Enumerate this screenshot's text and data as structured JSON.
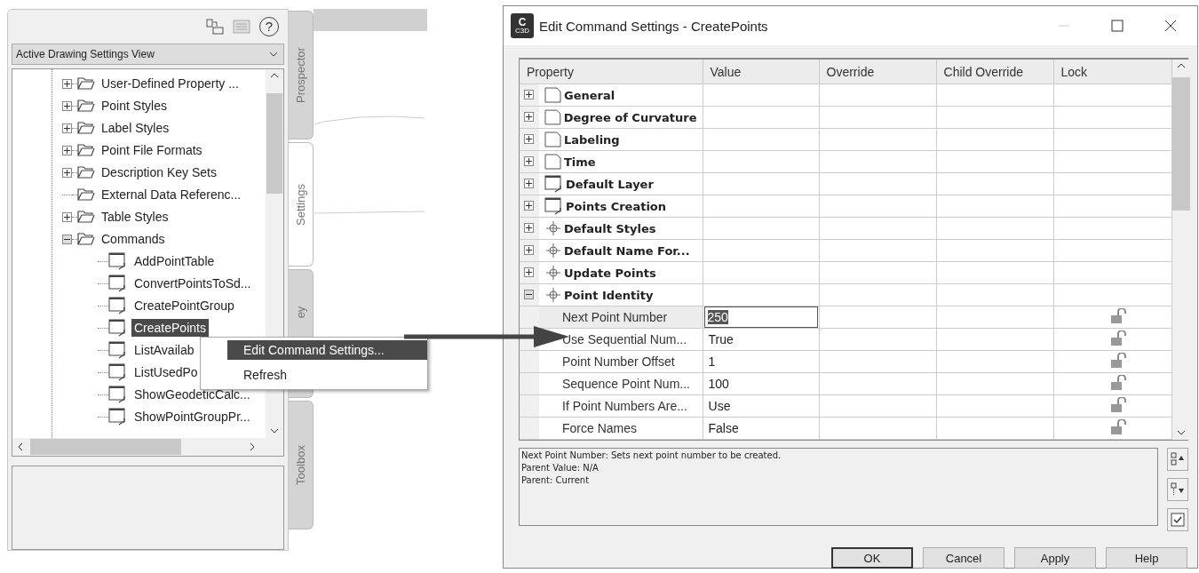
{
  "palette": {
    "help_button": "?",
    "view_dropdown": {
      "value": "Active Drawing Settings View"
    },
    "tree": [
      {
        "label": "User-Defined Property ...",
        "expanded": false,
        "selected": false
      },
      {
        "label": "Point Styles",
        "expanded": false,
        "selected": false
      },
      {
        "label": "Label Styles",
        "expanded": false,
        "selected": false
      },
      {
        "label": "Point File Formats",
        "expanded": false,
        "selected": false
      },
      {
        "label": "Description Key Sets",
        "expanded": false,
        "selected": false
      },
      {
        "label": "External Data Referenc...",
        "selected": false
      },
      {
        "label": "Table Styles",
        "expanded": false,
        "selected": false
      },
      {
        "label": "Commands",
        "expanded": true,
        "selected": false,
        "children": [
          {
            "label": "AddPointTable",
            "selected": false
          },
          {
            "label": "ConvertPointsToSd...",
            "selected": false
          },
          {
            "label": "CreatePointGroup",
            "selected": false
          },
          {
            "label": "CreatePoints",
            "selected": true
          },
          {
            "label": "ListAvailab",
            "selected": false
          },
          {
            "label": "ListUsedPo",
            "selected": false
          },
          {
            "label": "ShowGeodeticCalc...",
            "selected": false
          },
          {
            "label": "ShowPointGroupPr...",
            "selected": false
          }
        ]
      }
    ]
  },
  "side_tabs": [
    {
      "label": "Prospector",
      "selected": false
    },
    {
      "label": "Settings",
      "selected": true
    },
    {
      "label": "ey",
      "selected": false
    },
    {
      "label": "Toolbox",
      "selected": false
    }
  ],
  "context_menu": [
    {
      "label": "Edit Command Settings...",
      "selected": true
    },
    {
      "label": "Refresh",
      "selected": false
    }
  ],
  "dialog": {
    "logo": {
      "letter": "C",
      "caption": "C3D"
    },
    "title": "Edit Command Settings - CreatePoints",
    "minimize_disabled": true,
    "columns": [
      "Property",
      "Value",
      "Override",
      "Child Override",
      "Lock"
    ],
    "rows": [
      {
        "kind": "document",
        "label": "General",
        "expanded": false
      },
      {
        "kind": "document",
        "label": "Degree of Curvature",
        "expanded": false
      },
      {
        "kind": "document",
        "label": "Labeling",
        "expanded": false
      },
      {
        "kind": "document",
        "label": "Time",
        "expanded": false
      },
      {
        "kind": "command",
        "label": "Default Layer",
        "expanded": false
      },
      {
        "kind": "command",
        "label": "Points Creation",
        "expanded": false
      },
      {
        "kind": "point",
        "label": "Default Styles",
        "expanded": false
      },
      {
        "kind": "point",
        "label": "Default Name For...",
        "expanded": false
      },
      {
        "kind": "point",
        "label": "Update Points",
        "expanded": false
      },
      {
        "kind": "point",
        "label": "Point Identity",
        "expanded": true
      },
      {
        "kind": "property",
        "label": "Next Point Number",
        "value": "250",
        "selected": true,
        "locked": false
      },
      {
        "kind": "property",
        "label": "Use Sequential Num...",
        "value": "True",
        "selected": false,
        "locked": false
      },
      {
        "kind": "property",
        "label": "Point Number Offset",
        "value": "1",
        "selected": false,
        "locked": false
      },
      {
        "kind": "property",
        "label": "Sequence Point Num...",
        "value": "100",
        "selected": false,
        "locked": false
      },
      {
        "kind": "property",
        "label": "If Point Numbers Are...",
        "value": "Use",
        "selected": false,
        "locked": false
      },
      {
        "kind": "property",
        "label": "Force Names",
        "value": "False",
        "selected": false,
        "locked": false
      }
    ],
    "description": [
      "Next Point Number: Sets next point number to be created.",
      "Parent Value: N/A",
      "Parent: Current"
    ],
    "buttons": [
      {
        "label": "OK",
        "default": true
      },
      {
        "label": "Cancel",
        "default": false
      },
      {
        "label": "Apply",
        "default": false
      },
      {
        "label": "Help",
        "default": false
      }
    ]
  }
}
